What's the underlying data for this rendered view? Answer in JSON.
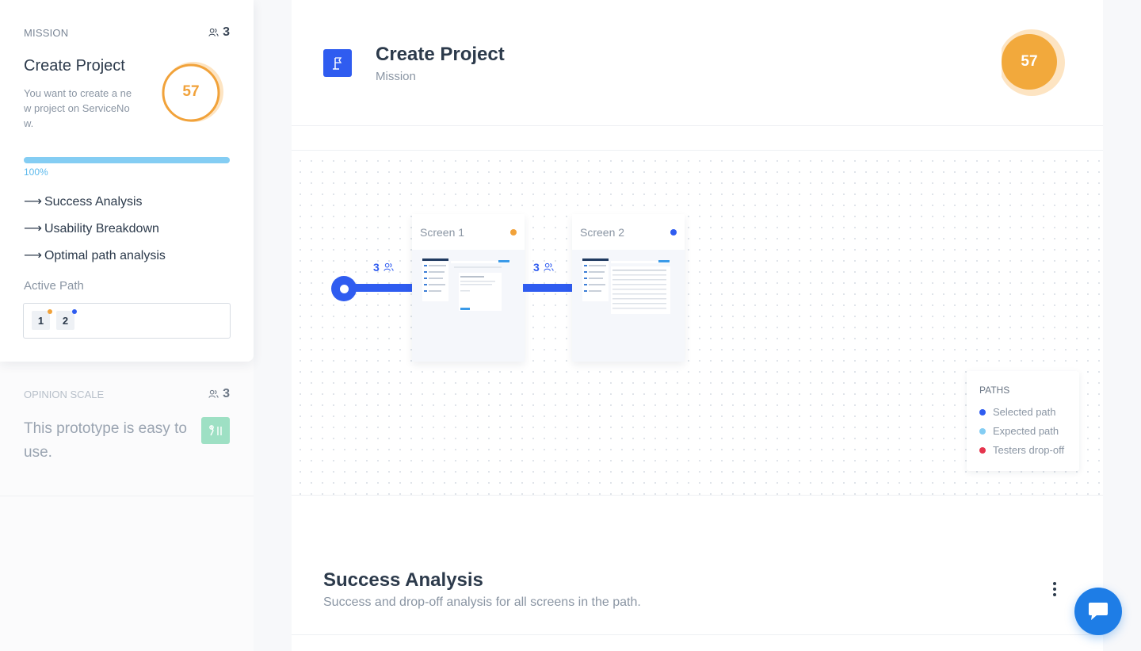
{
  "sidebar": {
    "mission_card": {
      "kicker": "MISSION",
      "tester_count": "3",
      "title": "Create Project",
      "description": "You want to create a new project on ServiceNow.",
      "score": "57",
      "score_fraction": 0.57,
      "progress_percent": 100,
      "progress_label": "100%",
      "links": [
        {
          "arrow": "⟶",
          "label": "Success Analysis"
        },
        {
          "arrow": "⟶",
          "label": "Usability Breakdown"
        },
        {
          "arrow": "⟶",
          "label": "Optimal path analysis"
        }
      ],
      "active_path_label": "Active Path",
      "active_path_steps": [
        {
          "label": "1",
          "dot_color": "#f1a23a"
        },
        {
          "label": "2",
          "dot_color": "#2f5cf0"
        }
      ]
    },
    "opinion_card": {
      "kicker": "OPINION SCALE",
      "tester_count": "3",
      "title": "This prototype is easy to use."
    }
  },
  "main": {
    "header": {
      "icon": "flag-icon",
      "title": "Create Project",
      "subtitle": "Mission",
      "score": "57",
      "score_fraction": 0.57
    },
    "flow": {
      "edges": [
        {
          "count": "3"
        },
        {
          "count": "3"
        }
      ],
      "screens": [
        {
          "name": "Screen 1",
          "dot_color": "#f1a23a"
        },
        {
          "name": "Screen 2",
          "dot_color": "#2f5cf0"
        }
      ],
      "legend": {
        "title": "PATHS",
        "items": [
          {
            "label": "Selected path",
            "color": "#2f5cf0"
          },
          {
            "label": "Expected path",
            "color": "#84cdf3"
          },
          {
            "label": "Testers drop-off",
            "color": "#e5344d"
          }
        ]
      }
    },
    "success_analysis": {
      "title": "Success Analysis",
      "subtitle": "Success and drop-off analysis for all screens in the path."
    }
  },
  "colors": {
    "accent": "#2f5cf0",
    "score_orange": "#f1a23a",
    "progress_blue": "#84cdf3",
    "chat_blue": "#1e7de6"
  }
}
